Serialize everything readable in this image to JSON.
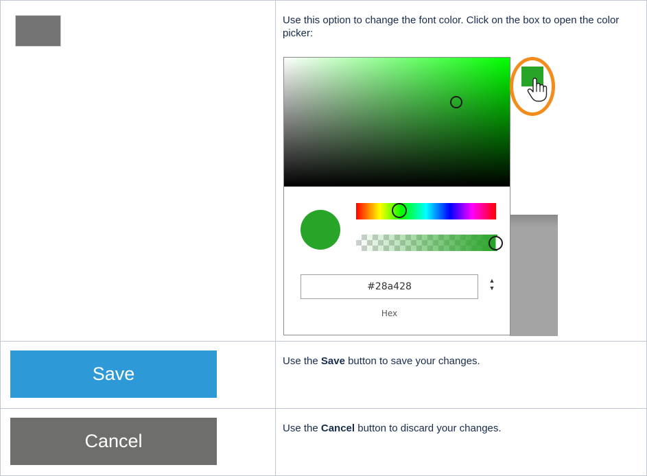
{
  "rows": [
    {
      "description": "Use this option to change the font color. Click on the box to open the color picker:"
    },
    {
      "button_label": "Save",
      "description_prefix": "Use the ",
      "description_bold": "Save",
      "description_suffix": " button to save your changes."
    },
    {
      "button_label": "Cancel",
      "description_prefix": "Use the ",
      "description_bold": "Cancel",
      "description_suffix": " button to discard your changes."
    }
  ],
  "color_picker": {
    "hex_value": "#28a428",
    "format_label": "Hex",
    "selected_color": "#28a428",
    "hue_color": "#00ff00",
    "hue_position": 0.33,
    "alpha_position": 1.0,
    "highlight_color": "#f28c1c",
    "font_color_swatch": "#737373"
  },
  "colors": {
    "save_button": "#2d9ad7",
    "cancel_button": "#6e6e6c"
  },
  "icons": [
    "hand-pointer-icon",
    "stepper-icon"
  ]
}
